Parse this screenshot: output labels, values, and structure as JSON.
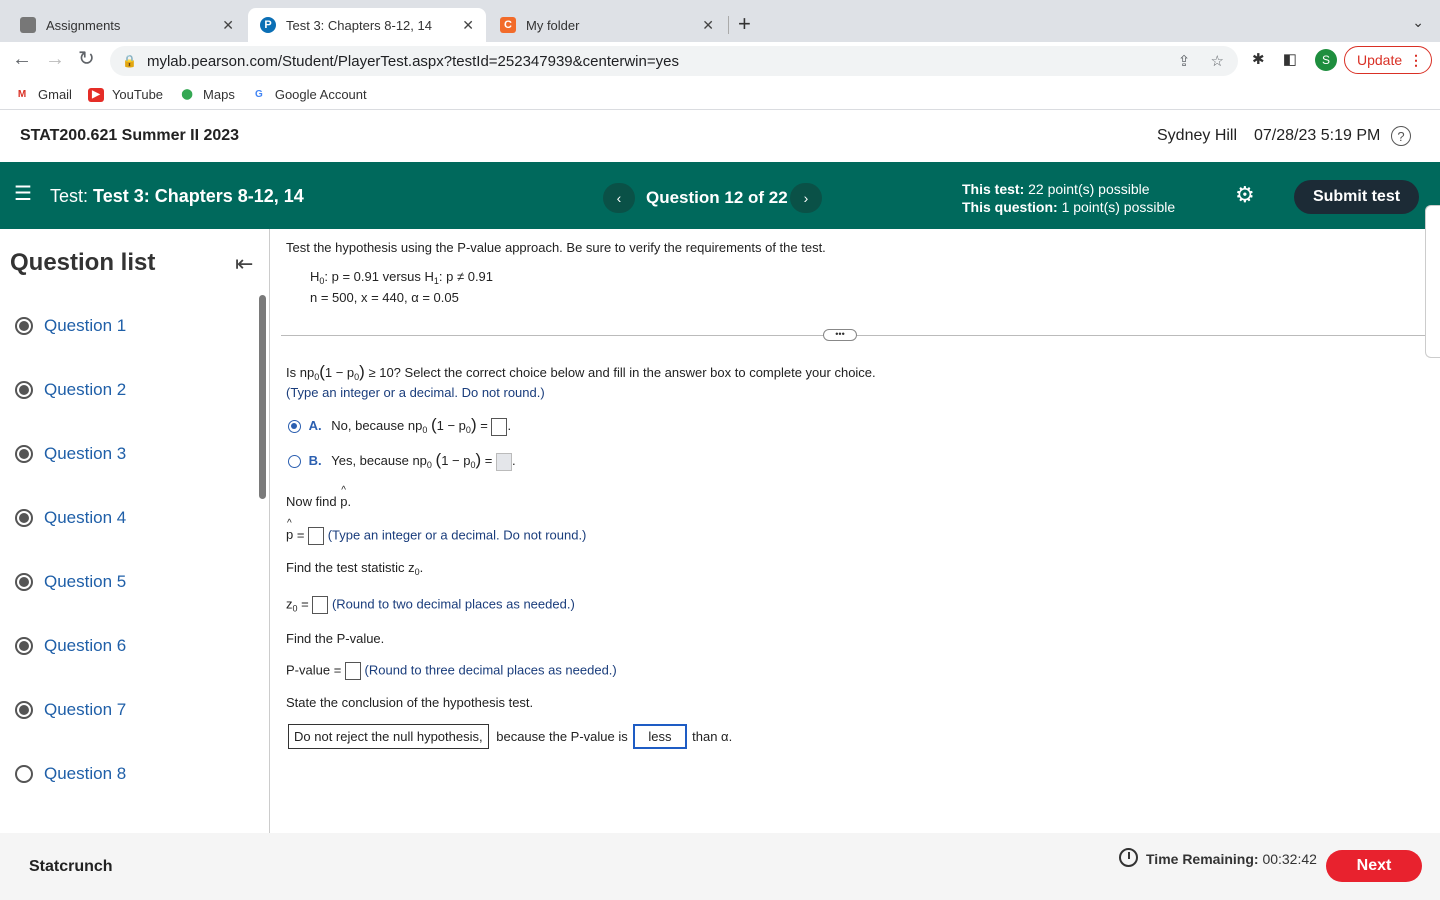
{
  "browser": {
    "tabs": [
      {
        "title": "Assignments",
        "active": false
      },
      {
        "title": "Test 3: Chapters 8-12, 14",
        "active": true
      },
      {
        "title": "My folder",
        "active": false
      }
    ],
    "url": "mylab.pearson.com/Student/PlayerTest.aspx?testId=252347939&centerwin=yes",
    "update_label": "Update",
    "profile_initial": "S",
    "bookmarks": [
      "Gmail",
      "YouTube",
      "Maps",
      "Google Account"
    ]
  },
  "course": {
    "title": "STAT200.621 Summer II 2023",
    "user": "Sydney Hill",
    "datetime": "07/28/23 5:19 PM"
  },
  "testbar": {
    "prefix": "Test:",
    "test_name": "Test 3: Chapters 8-12, 14",
    "question_counter": "Question 12 of 22",
    "test_points_label": "This test:",
    "test_points": "22 point(s) possible",
    "question_points_label": "This question:",
    "question_points": "1 point(s) possible",
    "submit_label": "Submit test"
  },
  "sidebar": {
    "title": "Question list",
    "items": [
      {
        "label": "Question 1",
        "answered": true
      },
      {
        "label": "Question 2",
        "answered": true
      },
      {
        "label": "Question 3",
        "answered": true
      },
      {
        "label": "Question 4",
        "answered": true
      },
      {
        "label": "Question 5",
        "answered": true
      },
      {
        "label": "Question 6",
        "answered": true
      },
      {
        "label": "Question 7",
        "answered": true
      },
      {
        "label": "Question 8",
        "answered": false
      }
    ]
  },
  "question": {
    "prompt": "Test the hypothesis using the P-value approach. Be sure to verify the requirements of the test.",
    "h0_text": ": p = 0.91 versus H",
    "h1_text": ": p ≠ 0.91",
    "params": "n = 500, x = 440, α = 0.05",
    "part1_pre": "Is np",
    "part1_post": "≥ 10? Select the correct choice below and fill in the answer box to complete your choice.",
    "part1_hint": "(Type an integer or a decimal. Do not round.)",
    "choice_a_letter": "A.",
    "choice_a_text": "No, because np",
    "choice_b_letter": "B.",
    "choice_b_text": "Yes, because np",
    "find_phat": "Now find",
    "phat_hint": "(Type an integer or a decimal. Do not round.)",
    "find_z": "Find the test statistic z",
    "z_hint": "(Round to two decimal places as needed.)",
    "find_p": "Find the P-value.",
    "pvalue_label": "P-value =",
    "pvalue_hint": "(Round to three decimal places as needed.)",
    "state_conclusion": "State the conclusion of the hypothesis test.",
    "conclusion_choice": "Do not reject the null hypothesis,",
    "conclusion_mid": "because the P-value is",
    "conclusion_compare": "less",
    "conclusion_end": "than α."
  },
  "footer": {
    "statcrunch": "Statcrunch",
    "time_label": "Time Remaining:",
    "time_value": "00:32:42",
    "next_label": "Next"
  },
  "colors": {
    "header_green": "#00695c",
    "submit_dark": "#1c2b36",
    "next_red": "#e8222e",
    "link_blue": "#1f5fa8"
  }
}
